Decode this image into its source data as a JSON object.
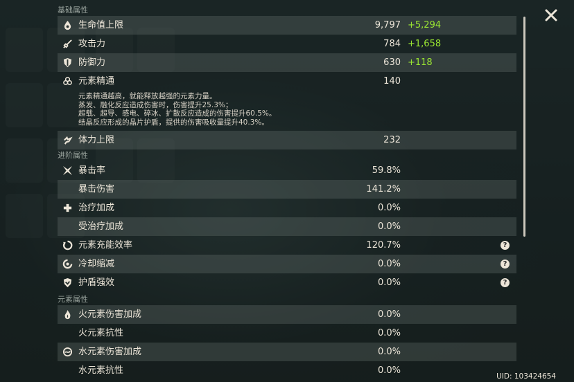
{
  "sections": {
    "basic": "基础属性",
    "advanced": "进阶属性",
    "elemental": "元素属性"
  },
  "basic": [
    {
      "icon": "hp-drop-icon",
      "label": "生命值上限",
      "value": "9,797",
      "bonus": "+5,294"
    },
    {
      "icon": "sword-icon",
      "label": "攻击力",
      "value": "784",
      "bonus": "+1,658"
    },
    {
      "icon": "shield-icon",
      "label": "防御力",
      "value": "630",
      "bonus": "+118"
    },
    {
      "icon": "elemental-mastery-icon",
      "label": "元素精通",
      "value": "140",
      "desc": [
        "元素精通越高，就能释放越强的元素力量。",
        "蒸发、融化反应造成伤害时，伤害提升25.3%；",
        "超载、超导、感电、碎冰、扩散反应造成的伤害提升60.5%。",
        "结晶反应形成的晶片护盾，提供的伤害吸收量提升40.3%。"
      ]
    },
    {
      "icon": "stamina-icon",
      "label": "体力上限",
      "value": "232"
    }
  ],
  "advanced": [
    {
      "icon": "crit-rate-icon",
      "label": "暴击率",
      "value": "59.8%"
    },
    {
      "icon": "",
      "label": "暴击伤害",
      "value": "141.2%"
    },
    {
      "icon": "healing-cross-icon",
      "label": "治疗加成",
      "value": "0.0%"
    },
    {
      "icon": "",
      "label": "受治疗加成",
      "value": "0.0%"
    },
    {
      "icon": "energy-recharge-icon",
      "label": "元素充能效率",
      "value": "120.7%",
      "help": "?"
    },
    {
      "icon": "cooldown-icon",
      "label": "冷却缩减",
      "value": "0.0%",
      "help": "?"
    },
    {
      "icon": "shield-strength-icon",
      "label": "护盾强效",
      "value": "0.0%",
      "help": "?"
    }
  ],
  "elemental": [
    {
      "icon": "pyro-icon",
      "label": "火元素伤害加成",
      "value": "0.0%"
    },
    {
      "icon": "",
      "label": "火元素抗性",
      "value": "0.0%"
    },
    {
      "icon": "hydro-icon",
      "label": "水元素伤害加成",
      "value": "0.0%"
    },
    {
      "icon": "",
      "label": "水元素抗性",
      "value": "0.0%"
    }
  ],
  "uid": "UID: 103424654",
  "colors": {
    "bonus": "#9be632",
    "text": "#ece5d8",
    "row_shade": "rgba(120,130,125,0.28)"
  }
}
